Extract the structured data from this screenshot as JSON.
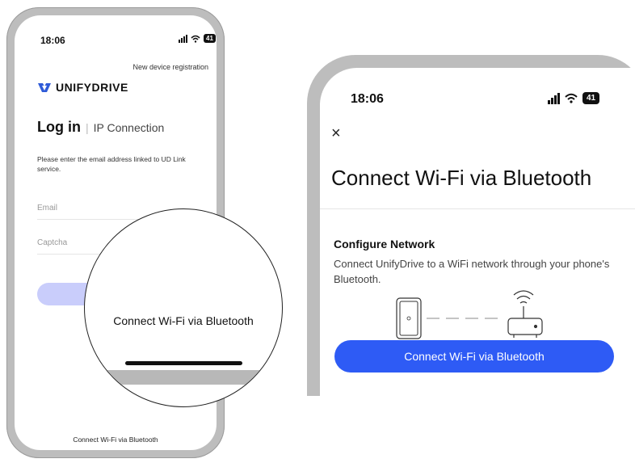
{
  "login_screen": {
    "status": {
      "time": "18:06",
      "battery": "41"
    },
    "new_registration_link": "New device registration",
    "brand": "UNIFYDRIVE",
    "tabs": {
      "login": "Log in",
      "separator": "|",
      "ip_connection": "IP Connection"
    },
    "description": "Please enter the email address linked to UD Link service.",
    "email_placeholder": "Email",
    "captcha_placeholder": "Captcha",
    "bluetooth_link": "Connect Wi-Fi via Bluetooth"
  },
  "magnifier": {
    "text": "Connect Wi-Fi via Bluetooth"
  },
  "bluetooth_screen": {
    "status": {
      "time": "18:06",
      "battery": "41"
    },
    "close_glyph": "×",
    "title": "Connect Wi-Fi via Bluetooth",
    "section_title": "Configure Network",
    "section_subtitle": "Connect UnifyDrive to a WiFi network through your phone's Bluetooth.",
    "primary_button": "Connect Wi-Fi via Bluetooth"
  },
  "colors": {
    "accent_blue": "#2e5bf5",
    "disabled_button": "#c9cdfb",
    "logo_blue": "#2f5bd8"
  },
  "icons": [
    "signal-icon",
    "wifi-icon",
    "battery-icon",
    "close-icon",
    "unifydrive-logo-icon",
    "device-icon",
    "router-icon"
  ]
}
